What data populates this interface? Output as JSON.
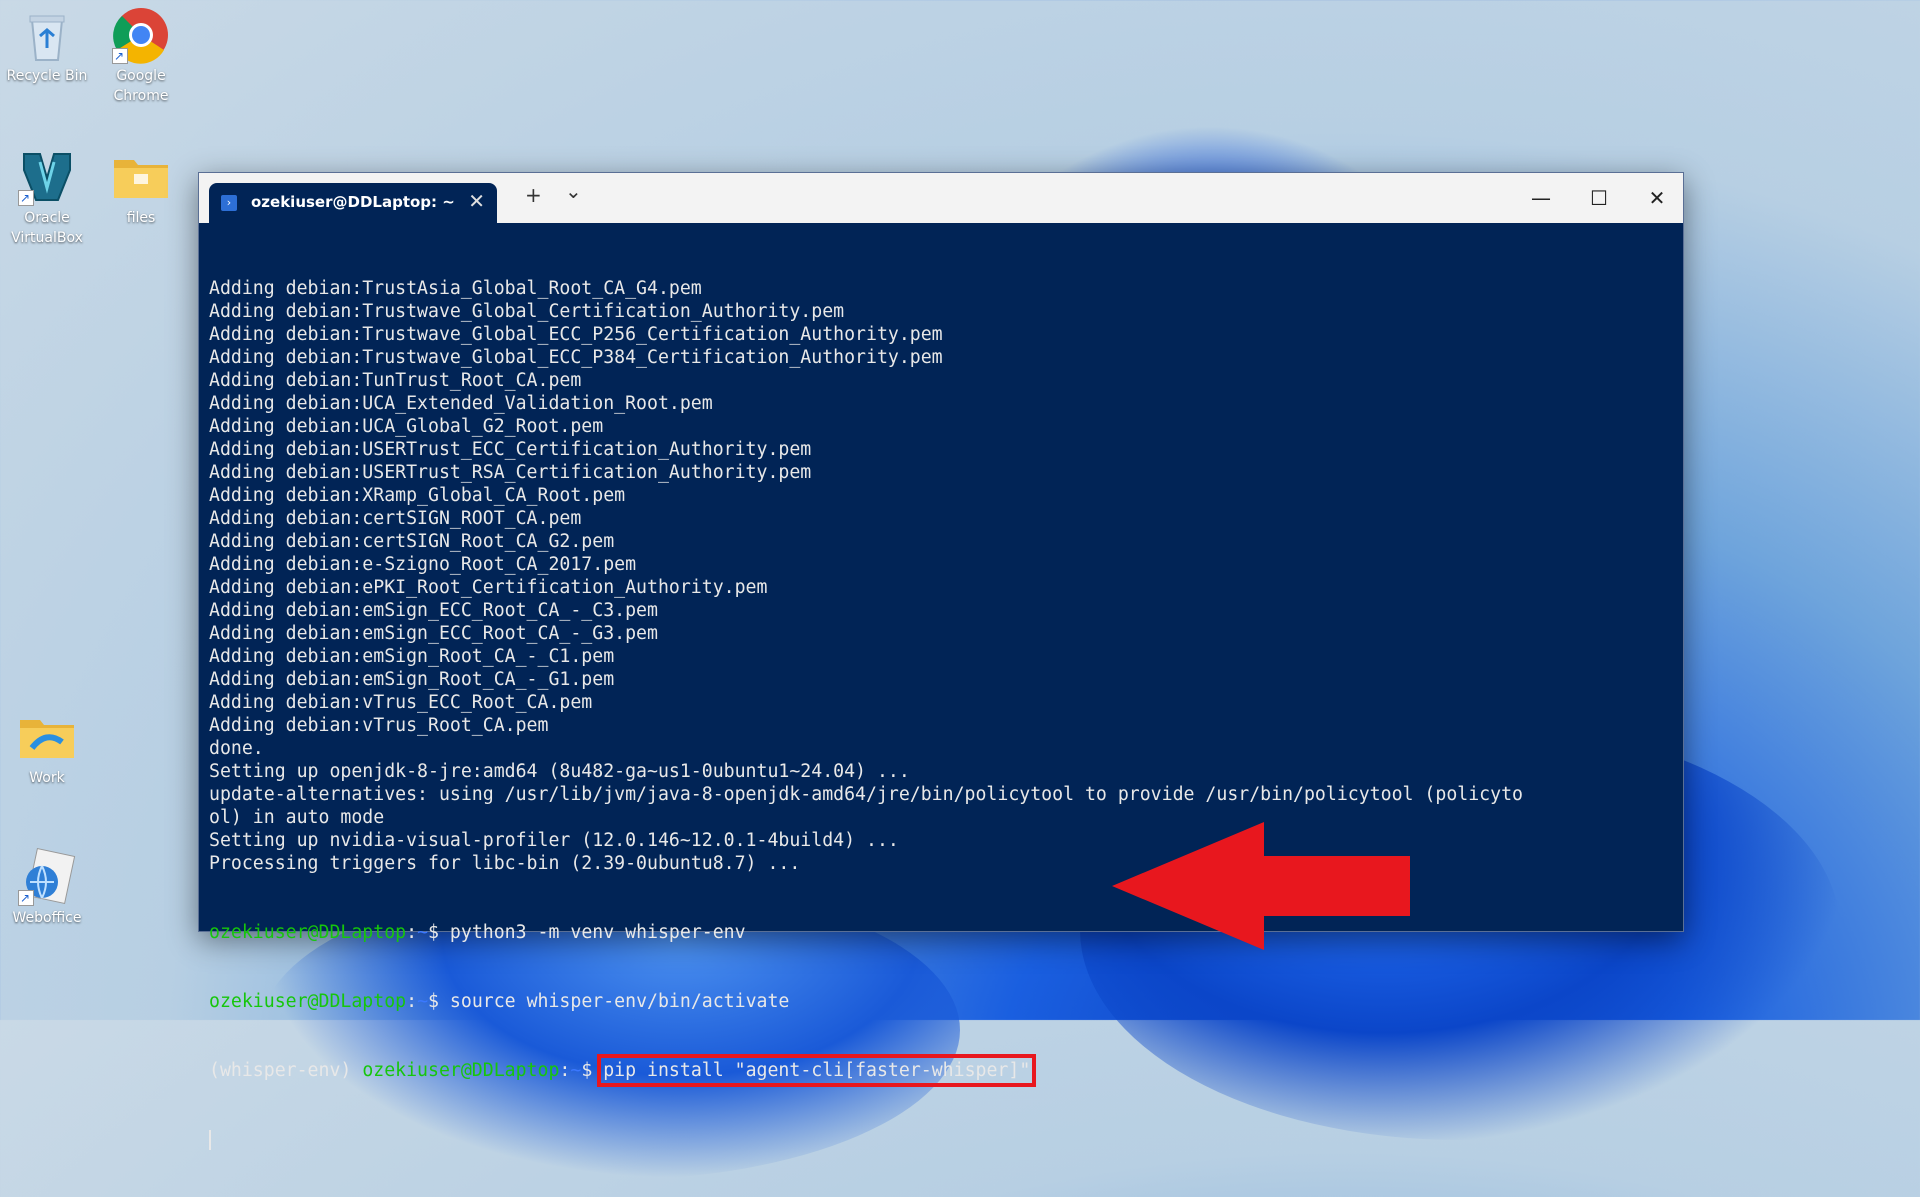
{
  "desktop": {
    "icons": [
      {
        "label": "Recycle Bin"
      },
      {
        "label": "Google\nChrome"
      },
      {
        "label": "Oracle\nVirtualBox"
      },
      {
        "label": "files"
      },
      {
        "label": "Work"
      },
      {
        "label": "Weboffice"
      }
    ]
  },
  "window": {
    "tab_title": "ozekiuser@DDLaptop: ~",
    "tab_close": "✕",
    "new_tab": "+",
    "dropdown": "⌄",
    "minimize": "—",
    "maximize": "☐",
    "close": "✕"
  },
  "terminal": {
    "lines": [
      "Adding debian:TrustAsia_Global_Root_CA_G4.pem",
      "Adding debian:Trustwave_Global_Certification_Authority.pem",
      "Adding debian:Trustwave_Global_ECC_P256_Certification_Authority.pem",
      "Adding debian:Trustwave_Global_ECC_P384_Certification_Authority.pem",
      "Adding debian:TunTrust_Root_CA.pem",
      "Adding debian:UCA_Extended_Validation_Root.pem",
      "Adding debian:UCA_Global_G2_Root.pem",
      "Adding debian:USERTrust_ECC_Certification_Authority.pem",
      "Adding debian:USERTrust_RSA_Certification_Authority.pem",
      "Adding debian:XRamp_Global_CA_Root.pem",
      "Adding debian:certSIGN_ROOT_CA.pem",
      "Adding debian:certSIGN_Root_CA_G2.pem",
      "Adding debian:e-Szigno_Root_CA_2017.pem",
      "Adding debian:ePKI_Root_Certification_Authority.pem",
      "Adding debian:emSign_ECC_Root_CA_-_C3.pem",
      "Adding debian:emSign_ECC_Root_CA_-_G3.pem",
      "Adding debian:emSign_Root_CA_-_C1.pem",
      "Adding debian:emSign_Root_CA_-_G1.pem",
      "Adding debian:vTrus_ECC_Root_CA.pem",
      "Adding debian:vTrus_Root_CA.pem",
      "done.",
      "Setting up openjdk-8-jre:amd64 (8u482-ga~us1-0ubuntu1~24.04) ...",
      "update-alternatives: using /usr/lib/jvm/java-8-openjdk-amd64/jre/bin/policytool to provide /usr/bin/policytool (policyto",
      "ol) in auto mode",
      "Setting up nvidia-visual-profiler (12.0.146~12.0.1-4build4) ...",
      "Processing triggers for libc-bin (2.39-0ubuntu8.7) ..."
    ],
    "prompt_user": "ozekiuser@DDLaptop",
    "prompt_colon": ":",
    "prompt_tilde": "~",
    "prompt_dollar": "$ ",
    "cmd1": "python3 -m venv whisper-env",
    "cmd2": "source whisper-env/bin/activate",
    "venv_prefix": "(whisper-env) ",
    "cmd3": "pip install \"agent-cli[faster-whisper]\""
  },
  "colors": {
    "terminal_bg": "#012456",
    "prompt_green": "#16c60c",
    "prompt_blue": "#3b78ff",
    "highlight_red": "#e8171e"
  },
  "icons": [
    "recycle-bin-icon",
    "chrome-icon",
    "virtualbox-icon",
    "folder-icon",
    "work-folder-icon",
    "weboffice-icon",
    "powershell-icon"
  ]
}
